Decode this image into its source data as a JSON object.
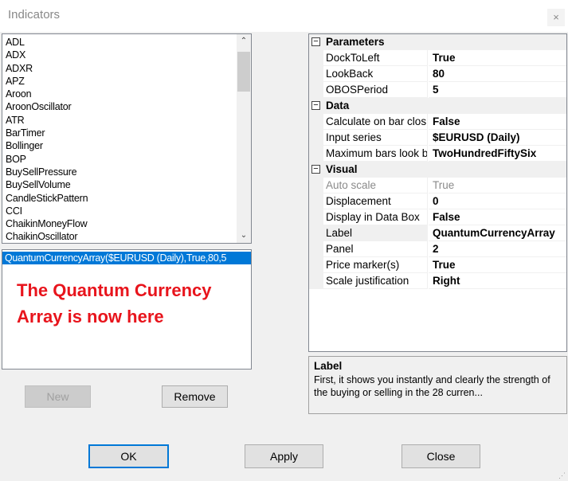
{
  "window": {
    "title": "Indicators",
    "close_glyph": "×"
  },
  "indicator_list": {
    "items": [
      "ADL",
      "ADX",
      "ADXR",
      "APZ",
      "Aroon",
      "AroonOscillator",
      "ATR",
      "BarTimer",
      "Bollinger",
      "BOP",
      "BuySellPressure",
      "BuySellVolume",
      "CandleStickPattern",
      "CCI",
      "ChaikinMoneyFlow",
      "ChaikinOscillator"
    ],
    "scroll_up_glyph": "⌃",
    "scroll_down_glyph": "⌄"
  },
  "selected_indicators": {
    "items": [
      "QuantumCurrencyArray($EURUSD (Daily),True,80,5"
    ],
    "annotation": "The Quantum Currency Array is now here"
  },
  "buttons": {
    "new": "New",
    "remove": "Remove",
    "ok": "OK",
    "apply": "Apply",
    "close": "Close"
  },
  "property_grid": {
    "categories": [
      {
        "name": "Parameters",
        "expander": "⊟",
        "rows": [
          {
            "name": "DockToLeft",
            "value": "True"
          },
          {
            "name": "LookBack",
            "value": "80"
          },
          {
            "name": "OBOSPeriod",
            "value": "5"
          }
        ]
      },
      {
        "name": "Data",
        "expander": "⊟",
        "rows": [
          {
            "name": "Calculate on bar clos",
            "value": "False"
          },
          {
            "name": "Input series",
            "value": "$EURUSD (Daily)"
          },
          {
            "name": "Maximum bars look b",
            "value": "TwoHundredFiftySix"
          }
        ]
      },
      {
        "name": "Visual",
        "expander": "⊟",
        "rows": [
          {
            "name": "Auto scale",
            "value": "True",
            "disabled": true
          },
          {
            "name": "Displacement",
            "value": "0"
          },
          {
            "name": "Display in Data Box",
            "value": "False"
          },
          {
            "name": "Label",
            "value": "QuantumCurrencyArray",
            "selected": true
          },
          {
            "name": "Panel",
            "value": "2"
          },
          {
            "name": "Price marker(s)",
            "value": "True"
          },
          {
            "name": "Scale justification",
            "value": "Right"
          }
        ]
      }
    ]
  },
  "description": {
    "title": "Label",
    "text": "First, it shows you instantly and clearly the strength of the buying or selling in the 28 curren..."
  },
  "colors": {
    "selection": "#0078d7",
    "annotation": "#e8141c",
    "dialog_bg": "#f0f0f0"
  }
}
